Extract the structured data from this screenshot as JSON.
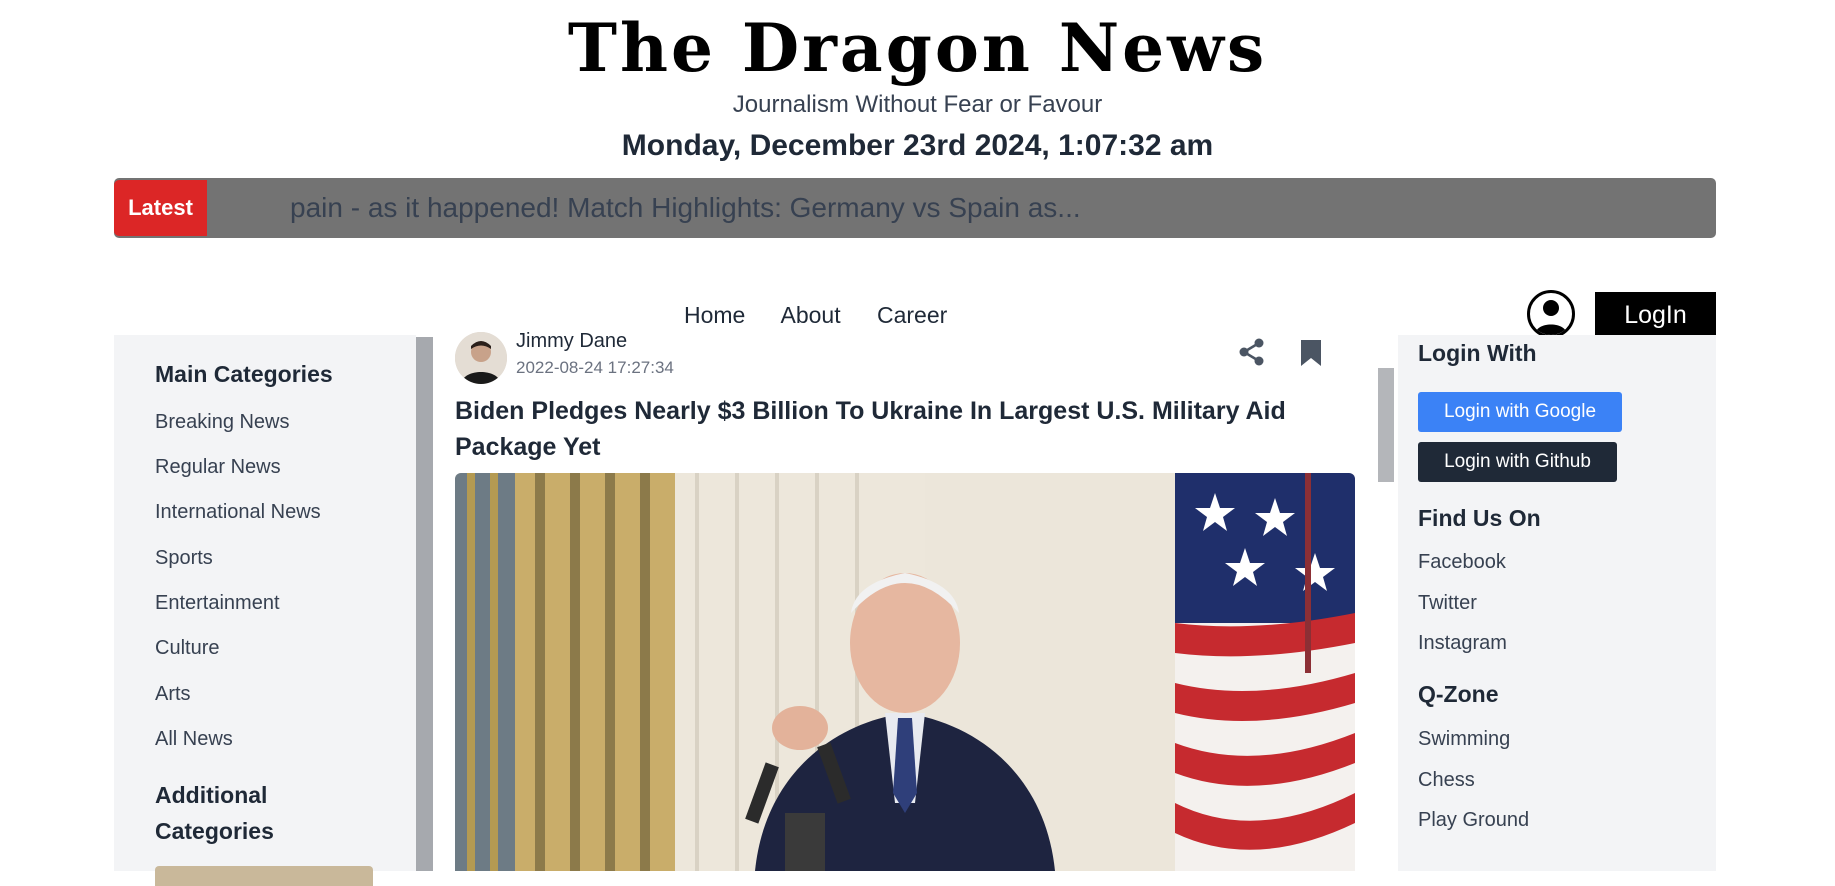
{
  "header": {
    "logo": "The Dragon News",
    "tagline": "Journalism Without Fear or Favour",
    "datetime": "Monday, December 23rd 2024, 1:07:32 am"
  },
  "ticker": {
    "badge": "Latest",
    "text": "pain - as it happened! Match Highlights: Germany vs Spain as..."
  },
  "nav": {
    "items": [
      "Home",
      "About",
      "Career"
    ],
    "login": "LogIn"
  },
  "left_sidebar": {
    "main_title": "Main Categories",
    "categories": [
      "Breaking News",
      "Regular News",
      "International News",
      "Sports",
      "Entertainment",
      "Culture",
      "Arts",
      "All News"
    ],
    "additional_title_line1": "Additional",
    "additional_title_line2": "Categories"
  },
  "article": {
    "author": "Jimmy Dane",
    "date": "2022-08-24 17:27:34",
    "title": "Biden Pledges Nearly $3 Billion To Ukraine In Largest U.S. Military Aid Package Yet"
  },
  "right_sidebar": {
    "login_title": "Login With",
    "google": "Login with Google",
    "github": "Login with Github",
    "find_title": "Find Us On",
    "social": [
      "Facebook",
      "Twitter",
      "Instagram"
    ],
    "qzone_title": "Q-Zone",
    "qzone": [
      "Swimming",
      "Chess",
      "Play Ground"
    ]
  },
  "colors": {
    "latest": "#dc2626",
    "google": "#3b82f6",
    "github": "#1f2937",
    "ticker": "#737373"
  },
  "icons": [
    "share-icon",
    "bookmark-icon",
    "user-icon"
  ]
}
